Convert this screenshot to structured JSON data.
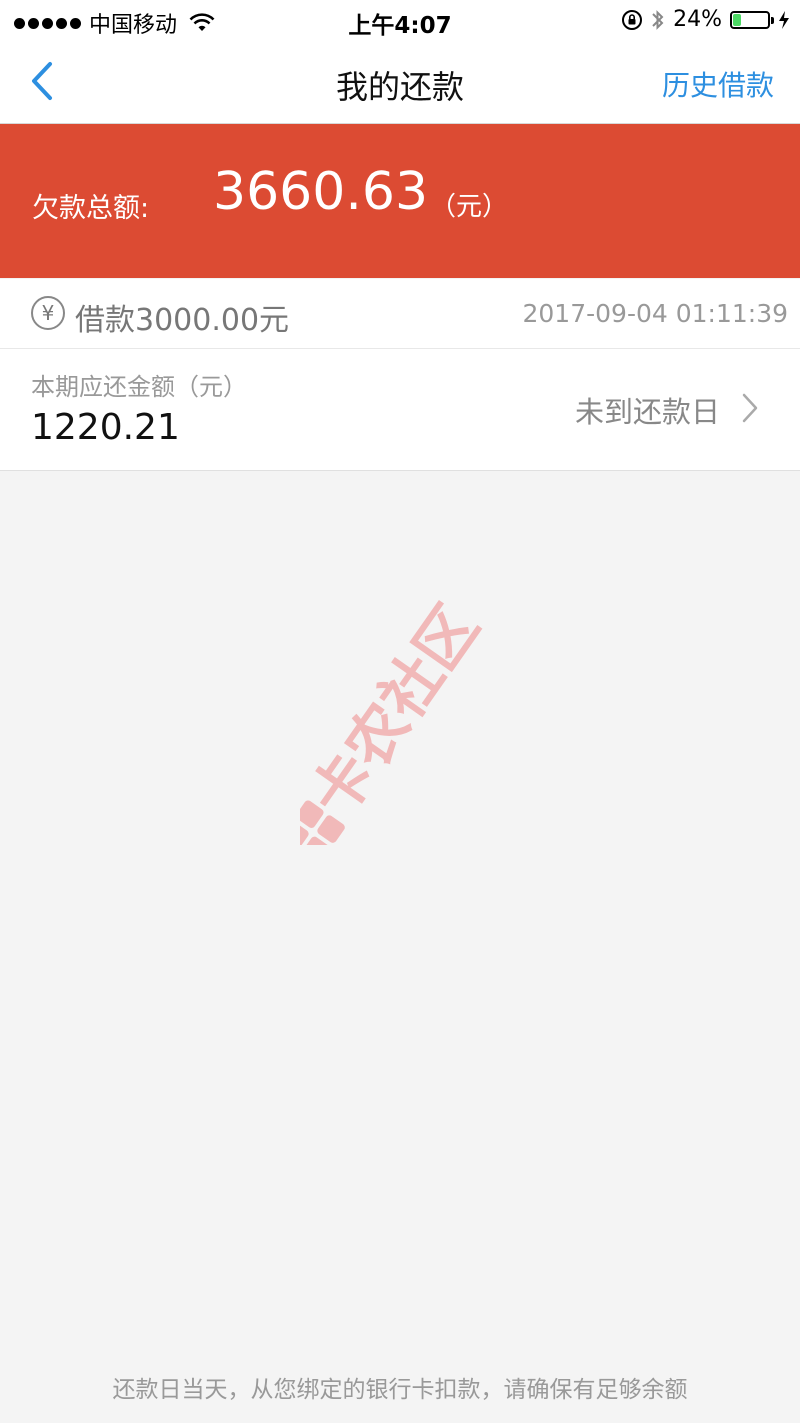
{
  "status_bar": {
    "carrier": "中国移动",
    "time": "上午4:07",
    "battery": "24%",
    "battery_level": 0.24
  },
  "nav": {
    "title": "我的还款",
    "right_link": "历史借款",
    "accent_color": "#2d8fe0"
  },
  "summary": {
    "label": "欠款总额:",
    "amount": "3660.63",
    "unit": "（元）",
    "banner_color": "#dc4b33"
  },
  "loan": {
    "currency_symbol": "¥",
    "title": "借款3000.00元",
    "datetime": "2017-09-04 01:11:39",
    "period_label": "本期应还金额（元）",
    "period_amount": "1220.21",
    "status": "未到还款日"
  },
  "watermark": {
    "text": "卡农社区"
  },
  "footer": {
    "note": "还款日当天，从您绑定的银行卡扣款，请确保有足够余额"
  }
}
